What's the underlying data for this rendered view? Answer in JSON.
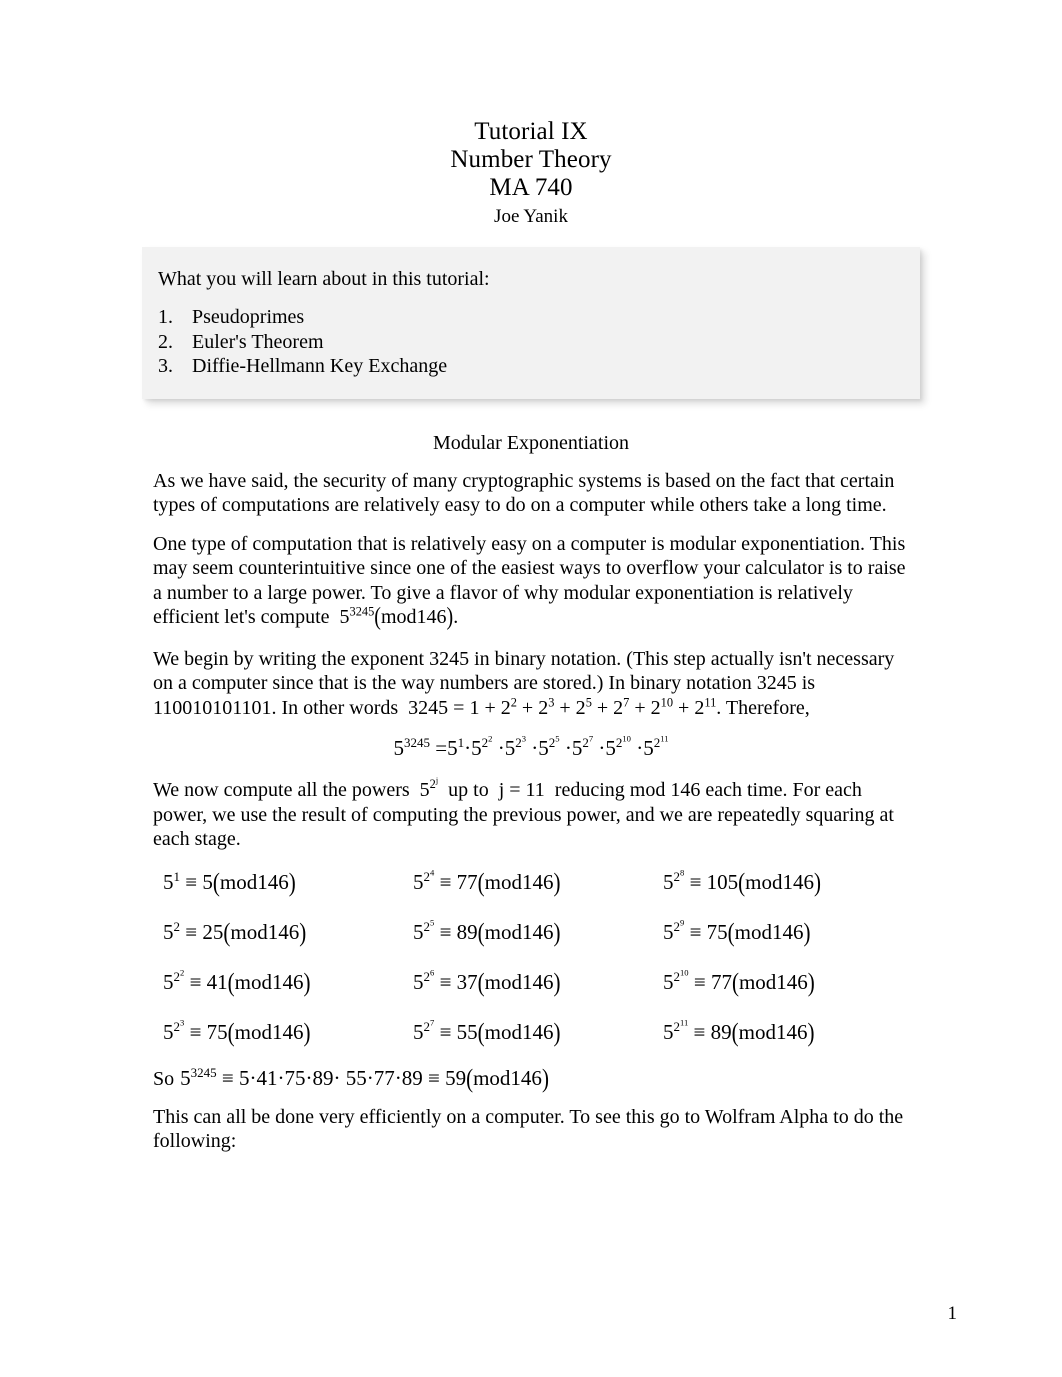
{
  "document": {
    "title_lines": [
      "Tutorial IX",
      "Number Theory",
      "MA 740"
    ],
    "author": "Joe Yanik",
    "page_number": "1"
  },
  "callout": {
    "intro": "What you will learn about in this tutorial:",
    "items": [
      {
        "num": "1.",
        "label": "Pseudoprimes"
      },
      {
        "num": "2.",
        "label": "Euler's Theorem"
      },
      {
        "num": "3.",
        "label": "Diffie-Hellmann Key Exchange"
      }
    ],
    "background_color": "#f2f2f2"
  },
  "section": {
    "heading": "Modular Exponentiation"
  },
  "paragraphs": {
    "p1": "As we have said, the security of many cryptographic systems is based on the fact that certain types of computations are relatively easy to do on a computer while others take a long time.",
    "p2_before_math": "One type of computation that is relatively easy on a computer is modular exponentiation. This may seem counterintuitive since one of the easiest ways to overflow your calculator is to raise a number to a large power. To give a flavor of why modular exponentiation is relatively efficient let's compute",
    "p2_math": "5^3245 (mod146)",
    "p2_after_math": ".",
    "p3_part1": "We begin by writing the exponent 3245 in binary notation. (This step actually isn't necessary on a computer since that is the way numbers are stored.) In binary notation 3245 is 110010101101. In other words",
    "p3_math": "3245 = 1 + 2^2 + 2^3 + 2^5 + 2^7 + 2^10 + 2^11",
    "p3_part2": ". Therefore,",
    "p4_part1": "We now compute all the powers",
    "p4_math1": "5^(2^j)",
    "p4_part2": "up to",
    "p4_math2": "j = 11",
    "p4_part3": "reducing mod 146 each time. For each power, we use the result of computing the previous power, and we are repeatedly squaring at each stage.",
    "p5": "This can all be done very efficiently on a computer. To see this go to Wolfram Alpha to do the following:"
  },
  "display_equation": {
    "base": "5",
    "lhs_exponent": "3245",
    "equals": "=",
    "factors": [
      {
        "base": "5",
        "exp_base": "",
        "exp": "1"
      },
      {
        "base": "5",
        "exp_base": "2",
        "exp": "2"
      },
      {
        "base": "5",
        "exp_base": "2",
        "exp": "3"
      },
      {
        "base": "5",
        "exp_base": "2",
        "exp": "5"
      },
      {
        "base": "5",
        "exp_base": "2",
        "exp": "7"
      },
      {
        "base": "5",
        "exp_base": "2",
        "exp": "10"
      },
      {
        "base": "5",
        "exp_base": "2",
        "exp": "11"
      }
    ]
  },
  "binary_sum": {
    "value": "3245",
    "terms": [
      "1",
      "2^2",
      "2^3",
      "2^5",
      "2^7",
      "2^10",
      "2^11"
    ]
  },
  "congruences": {
    "modulus": "146",
    "mod_label": "mod146",
    "cells": [
      {
        "base": "5",
        "exp_base": "",
        "exp": "1",
        "residue": "5"
      },
      {
        "base": "5",
        "exp_base": "",
        "exp": "2",
        "residue": "25"
      },
      {
        "base": "5",
        "exp_base": "2",
        "exp": "2",
        "residue": "41"
      },
      {
        "base": "5",
        "exp_base": "2",
        "exp": "3",
        "residue": "75"
      },
      {
        "base": "5",
        "exp_base": "2",
        "exp": "4",
        "residue": "77"
      },
      {
        "base": "5",
        "exp_base": "2",
        "exp": "5",
        "residue": "89"
      },
      {
        "base": "5",
        "exp_base": "2",
        "exp": "6",
        "residue": "37"
      },
      {
        "base": "5",
        "exp_base": "2",
        "exp": "7",
        "residue": "55"
      },
      {
        "base": "5",
        "exp_base": "2",
        "exp": "8",
        "residue": "105"
      },
      {
        "base": "5",
        "exp_base": "2",
        "exp": "9",
        "residue": "75"
      },
      {
        "base": "5",
        "exp_base": "2",
        "exp": "10",
        "residue": "77"
      },
      {
        "base": "5",
        "exp_base": "2",
        "exp": "11",
        "residue": "89"
      }
    ]
  },
  "result_line": {
    "prefix": "So",
    "base": "5",
    "exponent": "3245",
    "factors": [
      "5",
      "41",
      "75",
      "89",
      "55",
      "77",
      "89"
    ],
    "result": "59",
    "mod_label": "mod146"
  }
}
